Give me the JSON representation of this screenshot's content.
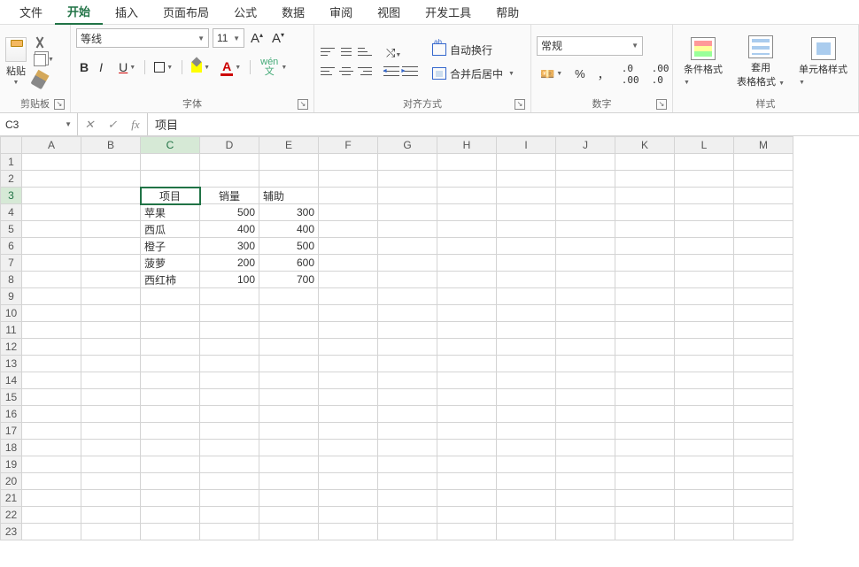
{
  "menu": {
    "items": [
      "文件",
      "开始",
      "插入",
      "页面布局",
      "公式",
      "数据",
      "审阅",
      "视图",
      "开发工具",
      "帮助"
    ],
    "active_index": 1
  },
  "ribbon": {
    "clipboard": {
      "title": "剪贴板",
      "paste_label": "粘贴"
    },
    "font": {
      "title": "字体",
      "name": "等线",
      "size": "11",
      "bold": "B",
      "italic": "I",
      "underline": "U",
      "wen": "wén\n文"
    },
    "alignment": {
      "title": "对齐方式",
      "wrap_label": "自动换行",
      "merge_label": "合并后居中"
    },
    "number": {
      "title": "数字",
      "format": "常规",
      "currency": "%",
      "comma": "，"
    },
    "styles": {
      "title": "样式",
      "cond": "条件格式",
      "table": "套用\n表格格式",
      "cell": "单元格样式"
    }
  },
  "formula_bar": {
    "cell_ref": "C3",
    "formula": "项目"
  },
  "grid": {
    "columns": [
      "A",
      "B",
      "C",
      "D",
      "E",
      "F",
      "G",
      "H",
      "I",
      "J",
      "K",
      "L",
      "M"
    ],
    "rows": 23,
    "active_cell": "C3",
    "headers": {
      "c3": "项目",
      "d3": "销量",
      "e3": "辅助"
    },
    "data": [
      {
        "c": "苹果",
        "d": 500,
        "e": 300
      },
      {
        "c": "西瓜",
        "d": 400,
        "e": 400
      },
      {
        "c": "橙子",
        "d": 300,
        "e": 500
      },
      {
        "c": "菠萝",
        "d": 200,
        "e": 600
      },
      {
        "c": "西红柿",
        "d": 100,
        "e": 700
      }
    ]
  }
}
